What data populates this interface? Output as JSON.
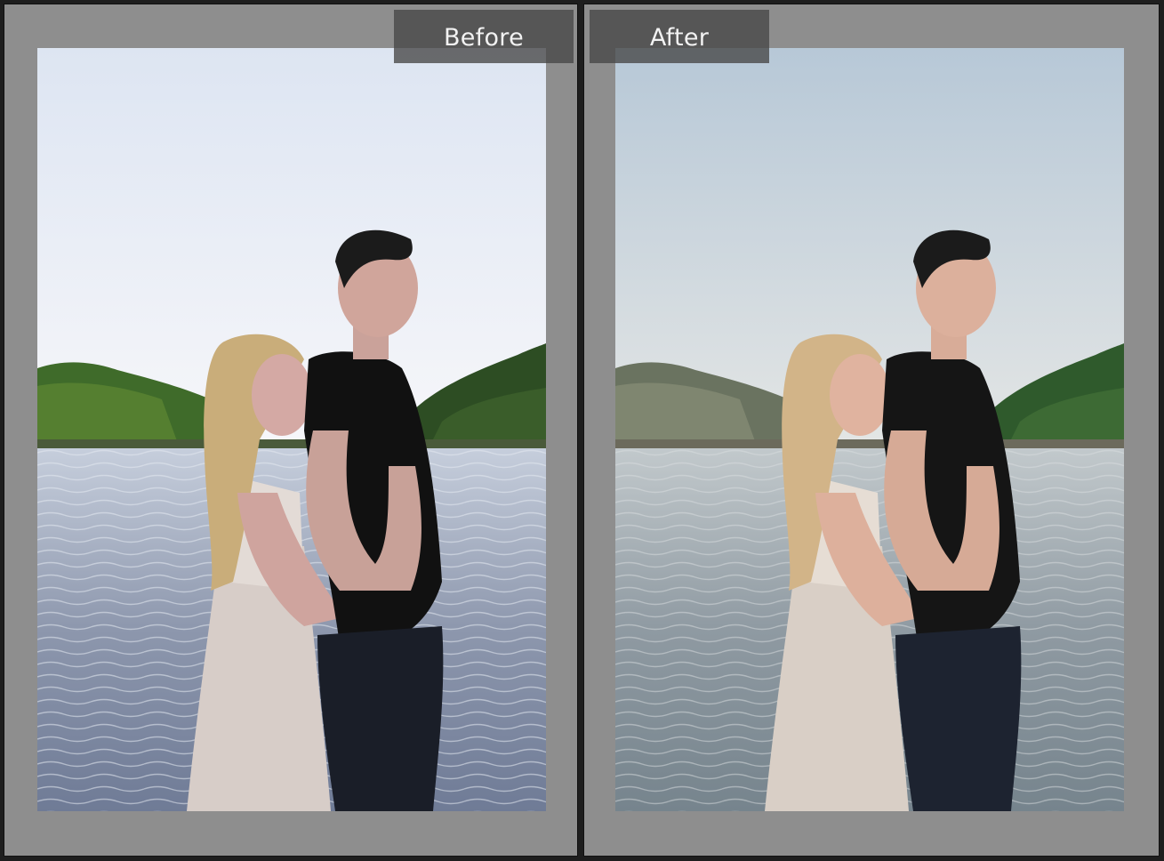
{
  "panels": [
    {
      "id": "before",
      "label": "Before"
    },
    {
      "id": "after",
      "label": "After"
    }
  ],
  "colors": {
    "background_gray": "#8e8e8e",
    "label_bg": "#464646",
    "label_text": "#f2f2f2",
    "before_sky_top": "#dfe6f2",
    "before_sky_bottom": "#f6f7fb",
    "after_sky_top": "#b9cad8",
    "after_sky_bottom": "#e3e6e6"
  },
  "icons": []
}
